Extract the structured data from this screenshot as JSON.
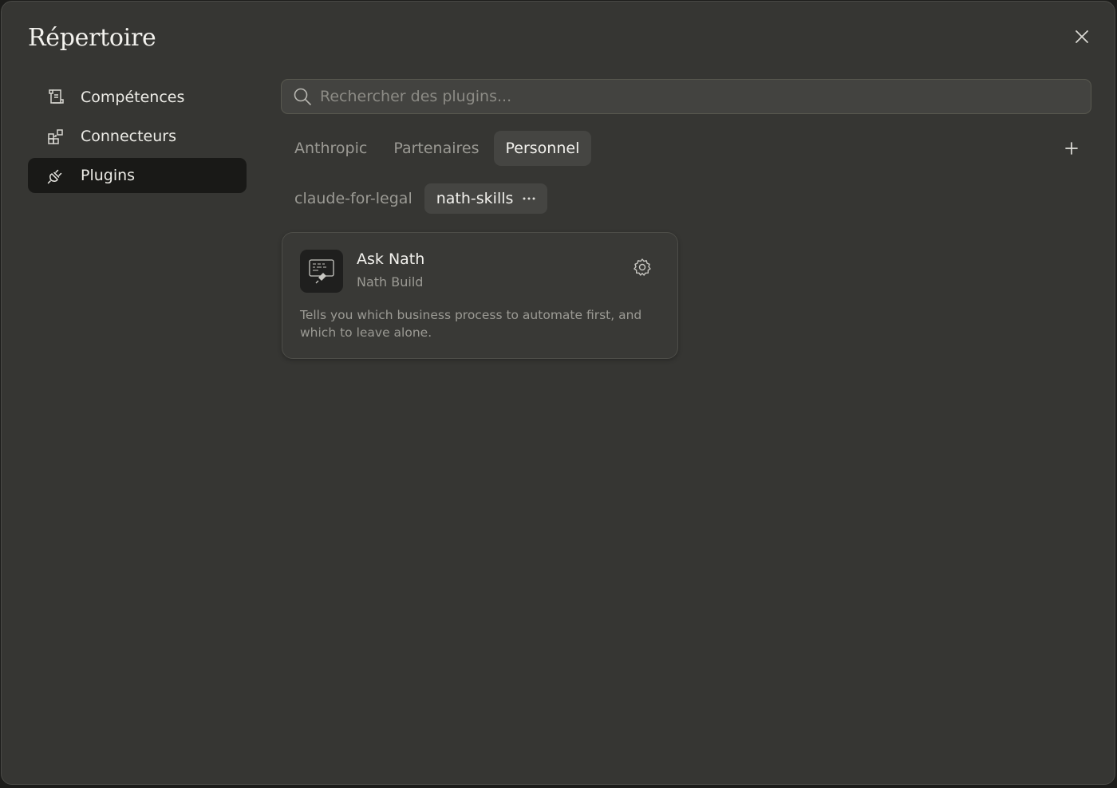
{
  "modal": {
    "title": "Répertoire"
  },
  "sidebar": {
    "items": [
      {
        "label": "Compétences",
        "icon": "skills-icon",
        "active": false
      },
      {
        "label": "Connecteurs",
        "icon": "connectors-icon",
        "active": false
      },
      {
        "label": "Plugins",
        "icon": "plug-icon",
        "active": true
      }
    ]
  },
  "search": {
    "placeholder": "Rechercher des plugins..."
  },
  "tabs": [
    {
      "label": "Anthropic"
    },
    {
      "label": "Partenaires"
    },
    {
      "label": "Personnel"
    }
  ],
  "subtabs": [
    {
      "label": "claude-for-legal"
    },
    {
      "label": "nath-skills"
    }
  ],
  "plugins": [
    {
      "name": "Ask Nath",
      "author": "Nath Build",
      "description": "Tells you which business process to automate first, and which to leave alone."
    }
  ],
  "colors": {
    "background": "#363633",
    "active_nav": "#191917",
    "active_tab": "#454542"
  }
}
